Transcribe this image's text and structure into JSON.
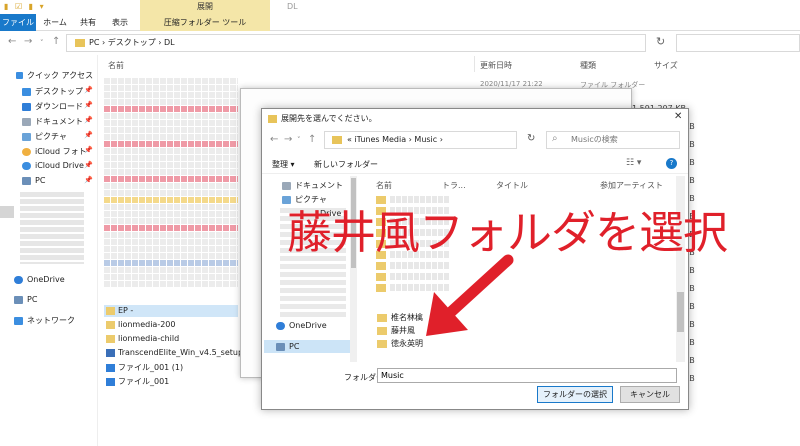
{
  "explorer": {
    "title": "DL",
    "context_group": "展開",
    "ribbon_tabs": [
      "ファイル",
      "ホーム",
      "共有",
      "表示",
      "圧縮フォルダー ツール"
    ],
    "breadcrumb": [
      "PC",
      "デスクトップ",
      "DL"
    ],
    "columns": [
      "名前",
      "更新日時",
      "種類",
      "サイズ"
    ],
    "first_row": {
      "date": "2020/11/17 21:22",
      "type": "ファイル フォルダー"
    },
    "nav": {
      "quick_access": "クイック アクセス",
      "items": [
        "デスクトップ",
        "ダウンロード",
        "ドキュメント",
        "ピクチャ",
        "iCloud フォト",
        "iCloud Drive",
        "PC"
      ],
      "onedrive": "OneDrive",
      "pc": "PC",
      "network": "ネットワーク"
    },
    "files": [
      "EP -",
      "lionmedia-200",
      "lionmedia-child",
      "TranscendElite_Win_v4.5_setup",
      "ファイル_001 (1)",
      "ファイル_001"
    ],
    "size_unit": "KB",
    "first_size": "1,591,207 KB"
  },
  "dialog": {
    "title": "展開先を選んでください。",
    "breadcrumb": "«  iTunes Media  ›  Music  ›",
    "search_placeholder": "Musicの検索",
    "toolbar": {
      "organize": "整理 ▾",
      "new_folder": "新しいフォルダー"
    },
    "nav": [
      "ドキュメント",
      "ピクチャ",
      "Drive",
      "OneDrive",
      "PC"
    ],
    "columns": [
      "名前",
      "トラ...",
      "タイトル",
      "参加アーティスト"
    ],
    "visible_folders": [
      "椎名林檎",
      "藤井風",
      "徳永英明"
    ],
    "folder_label": "フォルダー:",
    "folder_value": "Music",
    "select_button": "フォルダーの選択",
    "cancel_button": "キャンセル"
  },
  "annotation": {
    "text": "藤井風フォルダを選択",
    "color": "#e0202a"
  },
  "colors": {
    "accent": "#1979ca",
    "folder": "#eccb6c",
    "context_tab": "#f4e6a8"
  }
}
